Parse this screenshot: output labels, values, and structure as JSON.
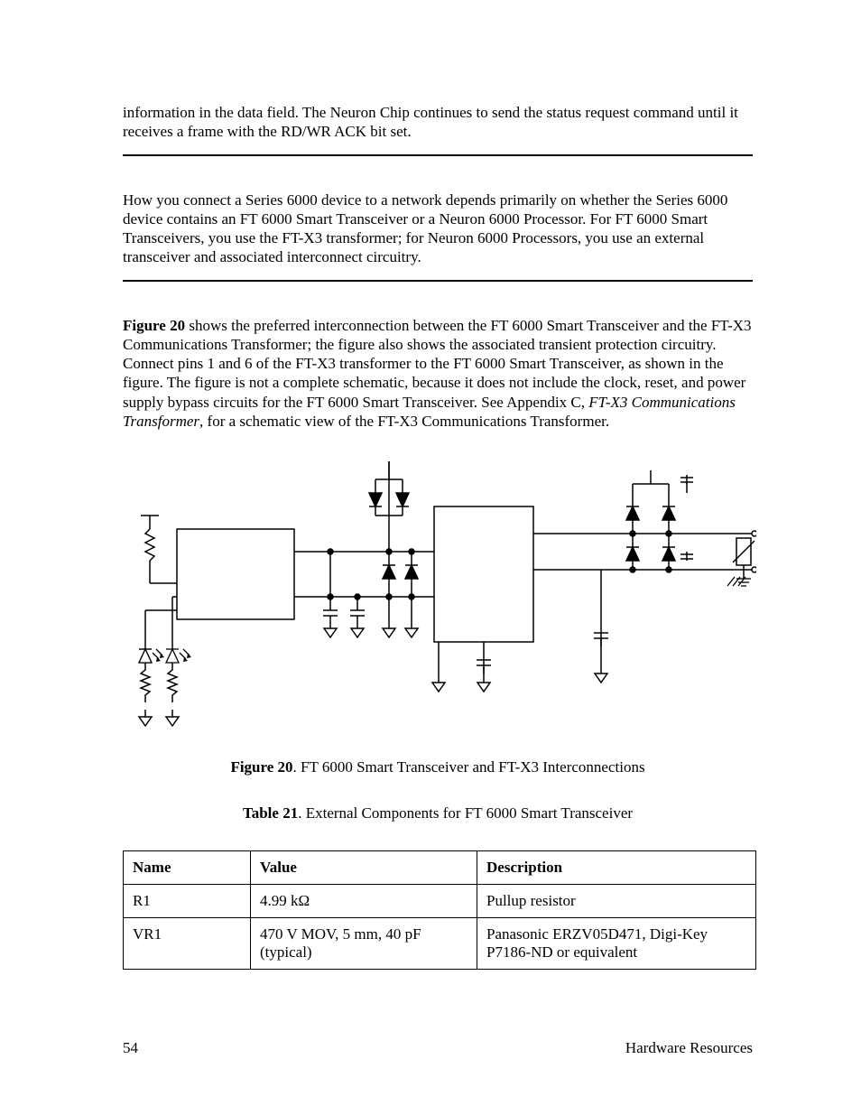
{
  "para_top": "information in the data field.  The Neuron Chip continues to send the status request command until it receives a frame with the RD/WR ACK bit set.",
  "para_mid": "How you connect a Series 6000 device to a network depends primarily on whether the Series 6000 device contains an FT 6000 Smart Transceiver or a Neuron 6000 Processor.  For FT 6000 Smart Transceivers, you use the FT-X3 transformer; for Neuron 6000 Processors, you use an external transceiver and associated interconnect circuitry.",
  "fig_ref_bold": "Figure 20",
  "fig_ref_rest_a": " shows the preferred interconnection between the FT 6000 Smart Transceiver and the FT-X3 Communications Transformer; the figure also shows the associated transient protection circuitry.  Connect pins 1 and 6 of the FT-X3 transformer to the FT 6000 Smart Transceiver, as shown in the figure.  The figure is not a complete schematic, because it does not include the clock, reset, and power supply bypass circuits for the FT 6000 Smart Transceiver.  See Appendix C, ",
  "fig_ref_italic": "FT-X3 Communications Transformer",
  "fig_ref_rest_b": ", for a schematic view of the FT-X3 Communications Transformer.",
  "figure_caption_bold": "Figure 20",
  "figure_caption_rest": ". FT 6000 Smart Transceiver and FT-X3 Interconnections",
  "table_caption_bold": "Table 21",
  "table_caption_rest": ". External Components for FT 6000 Smart Transceiver",
  "table": {
    "headers": [
      "Name",
      "Value",
      "Description"
    ],
    "rows": [
      [
        "R1",
        "4.99 kΩ",
        "Pullup resistor"
      ],
      [
        "VR1",
        "470 V MOV, 5 mm, 40 pF (typical)",
        "Panasonic ERZV05D471, Digi-Key P7186-ND or equivalent"
      ]
    ]
  },
  "footer_left": "54",
  "footer_right": "Hardware Resources"
}
